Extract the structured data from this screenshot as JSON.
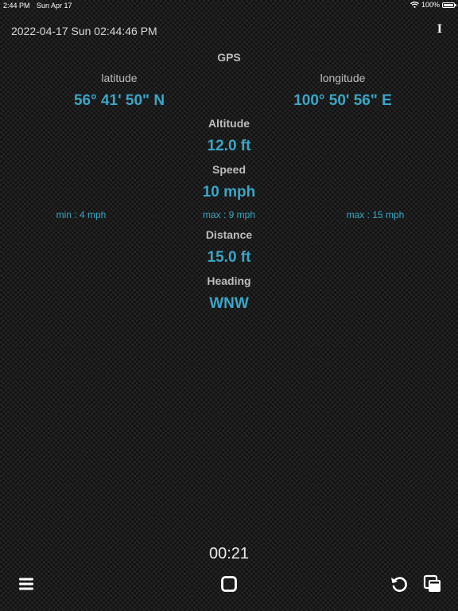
{
  "status_bar": {
    "time": "2:44 PM",
    "date": "Sun Apr 17",
    "battery": "100%",
    "battery_level": 1.0
  },
  "header": {
    "datetime": "2022-04-17 Sun 02:44:46 PM",
    "info_label": "I"
  },
  "gps": {
    "title": "GPS",
    "latitude_label": "latitude",
    "latitude_value": "56° 41' 50\" N",
    "longitude_label": "longitude",
    "longitude_value": "100° 50' 56\" E"
  },
  "altitude": {
    "label": "Altitude",
    "value": "12.0 ft"
  },
  "speed": {
    "label": "Speed",
    "value": "10 mph",
    "min": "min : 4 mph",
    "avg_max": "max : 9 mph",
    "max": "max : 15 mph"
  },
  "distance": {
    "label": "Distance",
    "value": "15.0 ft"
  },
  "heading": {
    "label": "Heading",
    "value": "WNW"
  },
  "timer": {
    "elapsed": "00:21"
  },
  "toolbar": {
    "icons": [
      "menu-icon",
      "stop-icon",
      "reset-icon",
      "copy-icon"
    ]
  },
  "colors": {
    "accent": "#3aa6c6",
    "label": "#bdbdbd"
  }
}
